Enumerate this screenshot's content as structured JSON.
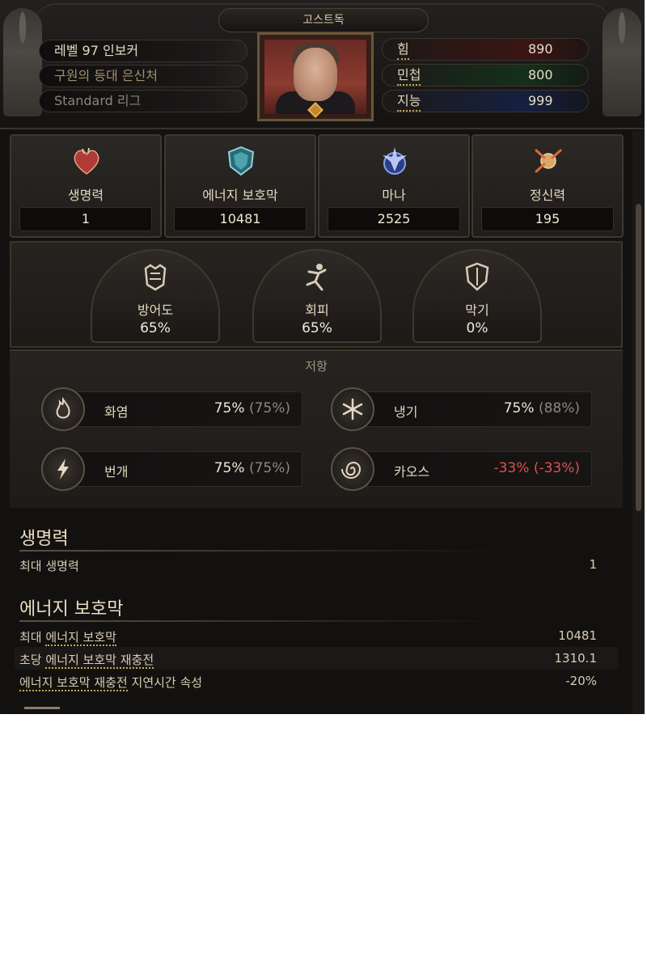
{
  "header": {
    "character_name": "고스트독",
    "level_text": "레벨 97 인보커",
    "class_text": "구원의 등대 은신처",
    "league_text": "Standard 리그"
  },
  "attributes": [
    {
      "label": "힘",
      "value": "890",
      "color": "#8a1e1a"
    },
    {
      "label": "민첩",
      "value": "800",
      "color": "#1e6a2c"
    },
    {
      "label": "지능",
      "value": "999",
      "color": "#213e8a"
    }
  ],
  "main_stats": {
    "life": {
      "label": "생명력",
      "value": "1",
      "icon": "heart-icon"
    },
    "energy_shield": {
      "label": "에너지 보호막",
      "value": "10481",
      "icon": "shield-crest-icon"
    },
    "mana": {
      "label": "마나",
      "value": "2525",
      "icon": "mana-crystal-icon"
    },
    "spirit": {
      "label": "정신력",
      "value": "195",
      "icon": "spirit-orb-icon"
    }
  },
  "defenses": {
    "armour": {
      "label": "방어도",
      "value": "65%",
      "icon": "armour-icon"
    },
    "evasion": {
      "label": "회피",
      "value": "65%",
      "icon": "evasion-icon"
    },
    "block": {
      "label": "막기",
      "value": "0%",
      "icon": "block-shield-icon"
    }
  },
  "resistances": {
    "title": "저항",
    "fire": {
      "label": "화염",
      "value": "75%",
      "max": "(75%)",
      "icon": "fire-icon"
    },
    "cold": {
      "label": "냉기",
      "value": "75%",
      "max": "(88%)",
      "icon": "cold-icon"
    },
    "lightning": {
      "label": "번개",
      "value": "75%",
      "max": "(75%)",
      "icon": "lightning-icon"
    },
    "chaos": {
      "label": "카오스",
      "value": "-33%",
      "max": "(-33%)",
      "icon": "chaos-icon",
      "color": "#e05050"
    }
  },
  "details": {
    "life_section": {
      "title": "생명력",
      "rows": [
        {
          "label": "최대 생명력",
          "value": "1"
        }
      ]
    },
    "es_section": {
      "title": "에너지 보호막",
      "rows": [
        {
          "label_underlined": "에너지 보호막",
          "label_prefix": "최대",
          "label_suffix": "",
          "value": "10481"
        },
        {
          "label_underlined": "에너지 보호막 재충전",
          "label_prefix": "초당",
          "label_suffix": "",
          "value": "1310.1"
        },
        {
          "label_underlined": "에너지 보호막 재충전",
          "label_prefix": "",
          "label_suffix": "지연시간 속성",
          "value": "-20%"
        }
      ]
    }
  }
}
